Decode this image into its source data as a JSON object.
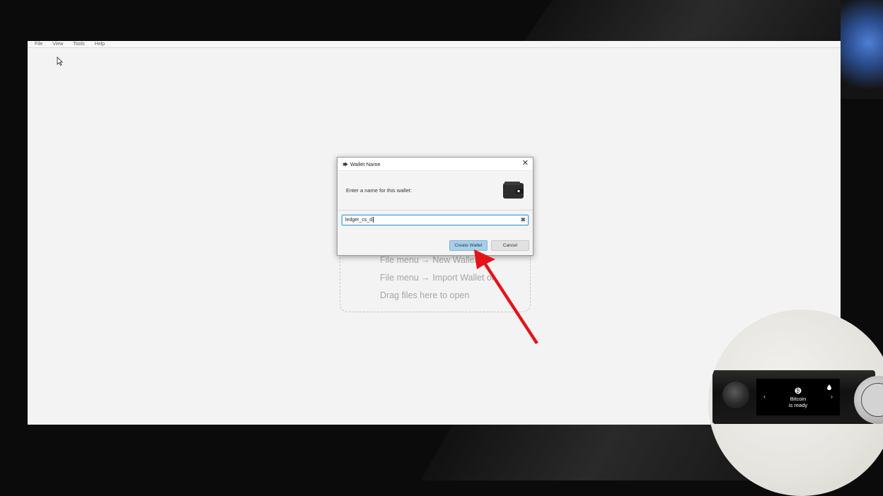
{
  "menu": {
    "items": [
      "File",
      "View",
      "Tools",
      "Help"
    ]
  },
  "welcome": {
    "lines": [
      "File menu → New Wallet or",
      "File menu → Import Wallet or",
      "Drag files here to open"
    ]
  },
  "dialog": {
    "title": "Wallet Name",
    "prompt": "Enter a name for this wallet:",
    "input_value": "ledger_cs_d",
    "create_label": "Create Wallet",
    "cancel_label": "Cancel",
    "close_icon": "close-icon",
    "header_icon": "wallet-icon"
  },
  "device": {
    "screen_line1": "Bitcoin",
    "screen_line2": "is ready",
    "nav_left": "‹",
    "nav_right": "›"
  },
  "colors": {
    "annotation_arrow": "#e4141b",
    "primary_button": "#a9cfe8",
    "input_focus": "#4aa0d6"
  }
}
